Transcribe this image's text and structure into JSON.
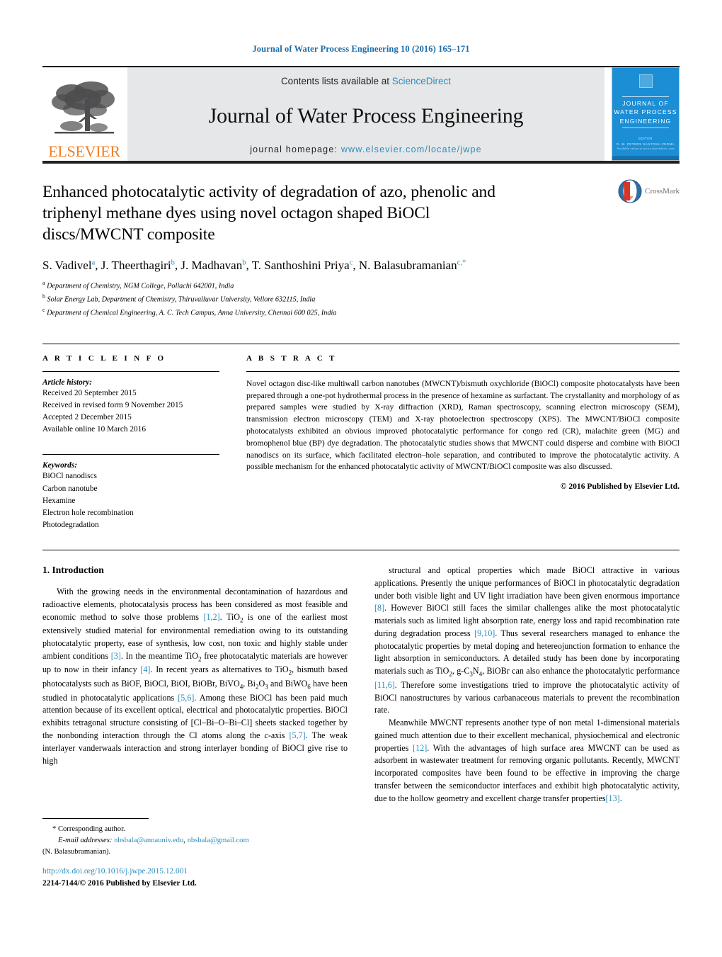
{
  "running_head": "Journal of Water Process Engineering 10 (2016) 165–171",
  "masthead": {
    "elsevier_wordmark": "ELSEVIER",
    "contents_prefix": "Contents lists available at ",
    "sciencedirect": "ScienceDirect",
    "journal_name": "Journal of Water Process Engineering",
    "homepage_prefix": "journal homepage: ",
    "homepage_url": "www.elsevier.com/locate/jwpe",
    "cover": {
      "title_line1": "JOURNAL OF",
      "title_line2": "WATER PROCESS",
      "title_line3": "ENGINEERING",
      "editor_label": "EDITOR",
      "editor_names": "R. W. PETERS    SANTOSH VERMA",
      "footer": "Available online at www.sciencedirect.com"
    },
    "link_color": "#2b8cbe",
    "banner_bg": "#e6e7e8",
    "elsevier_orange": "#f47d20"
  },
  "title": {
    "line1": "Enhanced photocatalytic activity of degradation of azo, phenolic and",
    "line2": "triphenyl methane dyes using novel octagon shaped BiOCl",
    "line3": "discs/MWCNT composite",
    "crossmark_label": "CrossMark"
  },
  "authors": {
    "list": [
      {
        "name": "S. Vadivel",
        "sup": "a"
      },
      {
        "name": "J. Theerthagiri",
        "sup": "b"
      },
      {
        "name": "J. Madhavan",
        "sup": "b"
      },
      {
        "name": "T. Santhoshini Priya",
        "sup": "c"
      },
      {
        "name": "N. Balasubramanian",
        "sup": "c,*"
      }
    ],
    "affiliations": [
      {
        "marker": "a",
        "text": "Department of Chemistry, NGM College, Pollachi 642001, India"
      },
      {
        "marker": "b",
        "text": "Solar Energy Lab, Department of Chemistry, Thiruvalluvar University, Vellore 632115, India"
      },
      {
        "marker": "c",
        "text": "Department of Chemical Engineering, A. C. Tech Campus, Anna University, Chennai 600 025, India"
      }
    ]
  },
  "article_info": {
    "heading": "A R T I C L E   I N F O",
    "history_label": "Article history:",
    "history": [
      "Received 20 September 2015",
      "Received in revised form 9 November 2015",
      "Accepted 2 December 2015",
      "Available online 10 March 2016"
    ],
    "keywords_label": "Keywords:",
    "keywords": [
      "BiOCl nanodiscs",
      "Carbon nanotube",
      "Hexamine",
      "Electron hole recombination",
      "Photodegradation"
    ]
  },
  "abstract": {
    "heading": "A B S T R A C T",
    "text": "Novel octagon disc-like multiwall carbon nanotubes (MWCNT)/bismuth oxychloride (BiOCl) composite photocatalysts have been prepared through a one-pot hydrothermal process in the presence of hexamine as surfactant. The crystallanity and morphology of as prepared samples were studied by X-ray diffraction (XRD), Raman spectroscopy, scanning electron microscopy (SEM), transmission electron microscopy (TEM) and X-ray photoelectron spectroscopy (XPS). The MWCNT/BiOCl composite photocatalysts exhibited an obvious improved photocatalytic performance for congo red (CR), malachite green (MG) and bromophenol blue (BP) dye degradation. The photocatalytic studies shows that MWCNT could disperse and combine with BiOCl nanodiscs on its surface, which facilitated electron–hole separation, and contributed to improve the photocatalytic activity. A possible mechanism for the enhanced photocatalytic activity of MWCNT/BiOCl composite was also discussed.",
    "copyright": "© 2016 Published by Elsevier Ltd."
  },
  "body": {
    "section_number_title": "1.  Introduction",
    "left_paragraph_html": "With the growing needs in the environmental decontamination of hazardous and radioactive elements, photocatalysis process has been considered as most feasible and economic method to solve those problems <span class=\"ref\">[1,2]</span>. TiO<sub>2</sub> is one of the earliest most extensively studied material for environmental remediation owing to its outstanding photocatalytic property, ease of synthesis, low cost, non toxic and highly stable under ambient conditions <span class=\"ref\">[3]</span>. In the meantime TiO<sub>2</sub> free photocatalytic materials are however up to now in their infancy <span class=\"ref\">[4]</span>. In recent years as alternatives to TiO<sub>2</sub>, bismuth based photocatalysts such as BiOF, BiOCl, BiOI, BiOBr, BiVO<sub>4</sub>, Bi<sub>2</sub>O<sub>3</sub> and BiWO<sub>6</sub> have been studied in photocatalytic applications <span class=\"ref\">[5,6]</span>. Among these BiOCl has been paid much attention because of its excellent optical, electrical and photocatalytic properties. BiOCl exhibits tetragonal structure consisting of [Cl–Bi–O–Bi–Cl] sheets stacked together by the nonbonding interaction through the Cl atoms along the <i>c</i>-axis <span class=\"ref\">[5,7]</span>. The weak interlayer vanderwaals interaction and strong interlayer bonding of BiOCl give rise to high",
    "right_paragraph1_html": "structural and optical properties which made BiOCl attractive in various applications. Presently the unique performances of BiOCl in photocatalytic degradation under both visible light and UV light irradiation have been given enormous importance <span class=\"ref\">[8]</span>. However BiOCl still faces the similar challenges alike the most photocatalytic materials such as limited light absorption rate, energy loss and rapid recombination rate during degradation process <span class=\"ref\">[9,10]</span>. Thus several researchers managed to enhance the photocatalytic properties by metal doping and hetereojunction formation to enhance the light absorption in semiconductors. A detailed study has been done by incorporating materials such as TiO<sub>2</sub>, g-C<sub>3</sub>N<sub>4</sub>, BiOBr can also enhance the photocatalytic performance <span class=\"ref\">[11,6]</span>. Therefore some investigations tried to improve the photocatalytic activity of BiOCl nanostructures by various carbanaceous materials to prevent the recombination rate.",
    "right_paragraph2_html": "Meanwhile MWCNT represents another type of non metal 1-dimensional materials gained much attention due to their excellent mechanical, physiochemical and electronic properties <span class=\"ref\">[12]</span>. With the advantages of high surface area MWCNT can be used as adsorbent in wastewater treatment for removing organic pollutants. Recently, MWCNT incorporated composites have been found to be effective in improving the charge transfer between the semiconductor interfaces and exhibit high photocatalytic activity, due to the hollow geometry and excellent charge transfer properties<span class=\"ref\">[13]</span>."
  },
  "footnote": {
    "corresponding": "* Corresponding author.",
    "email_label": "E-mail addresses:",
    "email1": "nbsbala@annauniv.edu",
    "email2": "nbsbala@gmail.com",
    "author_paren": "(N. Balasubramanian).",
    "doi": "http://dx.doi.org/10.1016/j.jwpe.2015.12.001",
    "issn": "2214-7144/© 2016 Published by Elsevier Ltd."
  }
}
